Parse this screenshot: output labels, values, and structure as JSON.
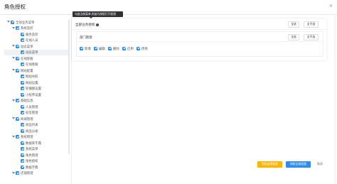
{
  "dialog": {
    "title": "角色授权",
    "close_symbol": "×"
  },
  "tree": [
    {
      "label": "全部业务菜单",
      "level": 0
    },
    {
      "label": "系统监控",
      "level": 1
    },
    {
      "label": "服务监控",
      "level": 2
    },
    {
      "label": "在线人员",
      "level": 2
    },
    {
      "label": "动态菜单",
      "level": 1
    },
    {
      "label": "动态菜单",
      "level": 2,
      "selected": true
    },
    {
      "label": "在线客服",
      "level": 1
    },
    {
      "label": "在线客服",
      "level": 2
    },
    {
      "label": "网站配置",
      "level": 1
    },
    {
      "label": "网站导航",
      "level": 2
    },
    {
      "label": "网站设置",
      "level": 2
    },
    {
      "label": "轮播图设置",
      "level": 2
    },
    {
      "label": "小程序设置",
      "level": 2
    },
    {
      "label": "基础信息",
      "level": 1
    },
    {
      "label": "人员管理",
      "level": 2
    },
    {
      "label": "标签管理",
      "level": 2
    },
    {
      "label": "商城管理",
      "level": 1
    },
    {
      "label": "商品列表",
      "level": 2
    },
    {
      "label": "商品分类",
      "level": 2
    },
    {
      "label": "系统管理",
      "level": 1
    },
    {
      "label": "数据库字典",
      "level": 2
    },
    {
      "label": "系统菜单",
      "level": 2
    },
    {
      "label": "角色管理",
      "level": 2
    },
    {
      "label": "角色授权",
      "level": 2
    },
    {
      "label": "数据字典",
      "level": 2
    },
    {
      "label": "店铺管理",
      "level": 1
    }
  ],
  "tooltip": "勾选当前菜单,则该为授权打开权限",
  "panel": {
    "title": "全部业务授权",
    "help_symbol": "?",
    "select_all": "全选",
    "select_none": "全不选"
  },
  "module": {
    "title": "部门管理",
    "select_all": "全选",
    "select_none": "全不选",
    "perms": [
      "新增",
      "编辑",
      "删除",
      "启用",
      "停用"
    ]
  },
  "footer": {
    "grant_selected": "授权选择权限",
    "grant_all": "授权全部权限",
    "cancel": "取消"
  },
  "colors": {
    "primary": "#2d8cf0",
    "warning": "#ffb400",
    "tooltip_bg": "#303133"
  }
}
